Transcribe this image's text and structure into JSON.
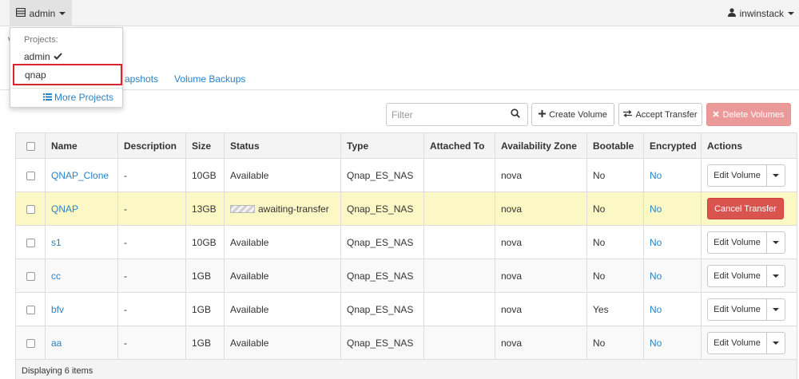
{
  "navbar": {
    "project_label": "admin",
    "user_label": "inwinstack"
  },
  "dropdown": {
    "header": "Projects:",
    "items": [
      {
        "label": "admin",
        "selected": true
      },
      {
        "label": "qnap",
        "selected": false
      }
    ],
    "more": "More Projects"
  },
  "tabs": {
    "snapshots_partial": "apshots",
    "backups": "Volume Backups"
  },
  "toolbar": {
    "filter_placeholder": "Filter",
    "create": "Create Volume",
    "accept": "Accept Transfer",
    "delete": "Delete Volumes"
  },
  "table": {
    "headers": [
      "Name",
      "Description",
      "Size",
      "Status",
      "Type",
      "Attached To",
      "Availability Zone",
      "Bootable",
      "Encrypted",
      "Actions"
    ],
    "rows": [
      {
        "name": "QNAP_Clone",
        "description": "-",
        "size": "10GB",
        "status": "Available",
        "type": "Qnap_ES_NAS",
        "attached": "",
        "zone": "nova",
        "bootable": "No",
        "encrypted": "No",
        "action": "Edit Volume"
      },
      {
        "name": "QNAP",
        "description": "-",
        "size": "13GB",
        "status": "awaiting-transfer",
        "type": "Qnap_ES_NAS",
        "attached": "",
        "zone": "nova",
        "bootable": "No",
        "encrypted": "No",
        "action": "Cancel Transfer"
      },
      {
        "name": "s1",
        "description": "-",
        "size": "10GB",
        "status": "Available",
        "type": "Qnap_ES_NAS",
        "attached": "",
        "zone": "nova",
        "bootable": "No",
        "encrypted": "No",
        "action": "Edit Volume"
      },
      {
        "name": "cc",
        "description": "-",
        "size": "1GB",
        "status": "Available",
        "type": "Qnap_ES_NAS",
        "attached": "",
        "zone": "nova",
        "bootable": "No",
        "encrypted": "No",
        "action": "Edit Volume"
      },
      {
        "name": "bfv",
        "description": "-",
        "size": "1GB",
        "status": "Available",
        "type": "Qnap_ES_NAS",
        "attached": "",
        "zone": "nova",
        "bootable": "Yes",
        "encrypted": "No",
        "action": "Edit Volume"
      },
      {
        "name": "aa",
        "description": "-",
        "size": "1GB",
        "status": "Available",
        "type": "Qnap_ES_NAS",
        "attached": "",
        "zone": "nova",
        "bootable": "No",
        "encrypted": "No",
        "action": "Edit Volume"
      }
    ],
    "footer": "Displaying 6 items"
  },
  "colors": {
    "link": "#2a82c6",
    "highlight_row": "#fcf8c6",
    "danger": "#d9534f",
    "danger_disabled": "#ec9a99",
    "selection_outline": "#d9232d"
  },
  "icons": {
    "project": "server-icon",
    "user": "user-icon",
    "check": "check-icon",
    "more": "list-icon",
    "search": "search-icon",
    "create": "plus-icon",
    "accept": "exchange-icon",
    "delete": "close-icon"
  }
}
